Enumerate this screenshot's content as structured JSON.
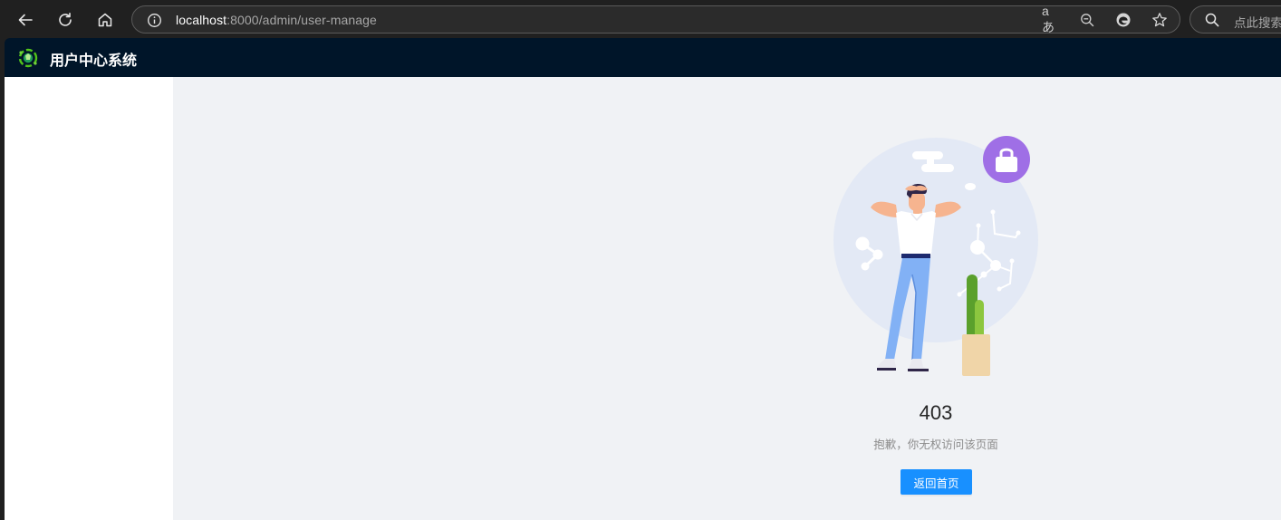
{
  "browser": {
    "url_host": "localhost",
    "url_path": ":8000/admin/user-manage",
    "read_aloud_label": "aあ",
    "search_placeholder": "点此搜索",
    "icons": [
      "back-arrow-icon",
      "refresh-icon",
      "home-icon",
      "site-info-icon",
      "read-aloud-icon",
      "zoom-out-icon",
      "edge-icon",
      "favorite-star-icon",
      "search-icon"
    ]
  },
  "header": {
    "title": "用户中心系统",
    "background_color": "#001529"
  },
  "result": {
    "status": "403",
    "subtitle": "抱歉，你无权访问该页面",
    "button_label": "返回首页",
    "button_color": "#1890ff"
  },
  "colors": {
    "content_bg": "#f0f2f5",
    "sidebar_bg": "#ffffff",
    "illustration_circle": "#e3e9f5",
    "lock_badge": "#9f6fe6"
  }
}
